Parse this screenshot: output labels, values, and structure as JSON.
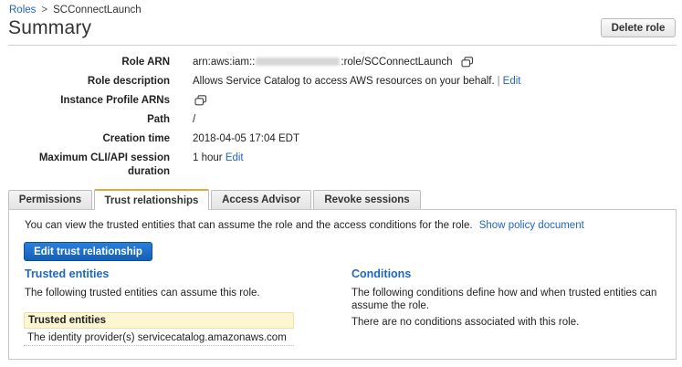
{
  "breadcrumb": {
    "parent": "Roles",
    "separator": ">",
    "current": "SCConnectLaunch"
  },
  "header": {
    "title": "Summary",
    "delete_label": "Delete role"
  },
  "summary": {
    "role_arn": {
      "label": "Role ARN",
      "prefix": "arn:aws:iam::",
      "suffix": ":role/SCConnectLaunch"
    },
    "role_description": {
      "label": "Role description",
      "value": "Allows Service Catalog to access AWS resources on your behalf.",
      "separator": "|",
      "edit_label": "Edit"
    },
    "instance_profile": {
      "label": "Instance Profile ARNs"
    },
    "path": {
      "label": "Path",
      "value": "/"
    },
    "creation_time": {
      "label": "Creation time",
      "value": "2018-04-05 17:04 EDT"
    },
    "max_session": {
      "label_line1": "Maximum CLI/API session",
      "label_line2": "duration",
      "value": "1 hour",
      "edit_label": "Edit"
    }
  },
  "tabs": [
    {
      "label": "Permissions",
      "active": false
    },
    {
      "label": "Trust relationships",
      "active": true
    },
    {
      "label": "Access Advisor",
      "active": false
    },
    {
      "label": "Revoke sessions",
      "active": false
    }
  ],
  "panel": {
    "intro": "You can view the trusted entities that can assume the role and the access conditions for the role.",
    "show_policy_label": "Show policy document",
    "edit_button_label": "Edit trust relationship",
    "trusted": {
      "heading": "Trusted entities",
      "description": "The following trusted entities can assume this role.",
      "table_header": "Trusted entities",
      "rows": [
        "The identity provider(s) servicecatalog.amazonaws.com"
      ]
    },
    "conditions": {
      "heading": "Conditions",
      "description_line1": "The following conditions define how and when trusted entities can",
      "description_line2": "assume the role.",
      "empty_text": "There are no conditions associated with this role."
    }
  }
}
